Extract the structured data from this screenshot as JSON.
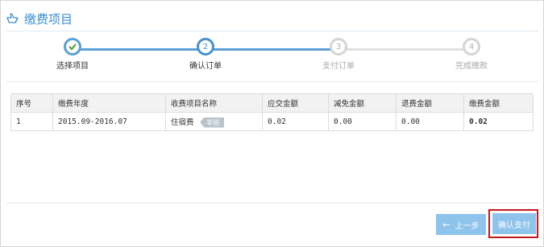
{
  "header": {
    "title": "缴费项目",
    "icon": "hand-pointing-icon"
  },
  "steps": [
    {
      "num": "",
      "label": "选择项目",
      "state": "done"
    },
    {
      "num": "2",
      "label": "确认订单",
      "state": "current"
    },
    {
      "num": "3",
      "label": "支付订单",
      "state": "todo"
    },
    {
      "num": "4",
      "label": "完成缴款",
      "state": "todo"
    }
  ],
  "table": {
    "headers": [
      "序号",
      "缴费年度",
      "收费项目名称",
      "应交金额",
      "减免金额",
      "退费金额",
      "缴费金额"
    ],
    "rows": [
      [
        "1",
        "2015.09-2016.07",
        "住宿费",
        "0.02",
        "0.00",
        "0.00",
        "0.02"
      ]
    ],
    "tag": "非税"
  },
  "buttons": {
    "prev": "上一步",
    "confirm": "确认支付"
  },
  "colors": {
    "accent": "#3a8fd1",
    "button": "#8ec3ec",
    "highlight": "#c3161c",
    "amount": "#3c9a2a"
  }
}
